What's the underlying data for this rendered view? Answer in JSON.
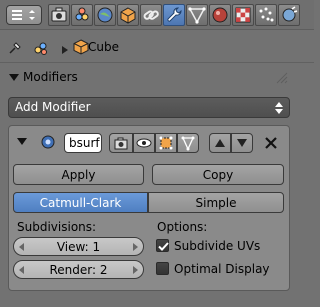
{
  "breadcrumb": {
    "object_name": "Cube"
  },
  "modifiers_section": {
    "title": "Modifiers"
  },
  "add_modifier": {
    "label": "Add Modifier"
  },
  "modifier": {
    "name": "bsurf",
    "apply_label": "Apply",
    "copy_label": "Copy",
    "algorithm": {
      "options": [
        "Catmull-Clark",
        "Simple"
      ],
      "selected": "Catmull-Clark"
    },
    "subdivisions": {
      "label": "Subdivisions:",
      "view": "View: 1",
      "render": "Render: 2"
    },
    "options": {
      "label": "Options:",
      "subdivide_uvs": {
        "label": "Subdivide UVs",
        "checked": true
      },
      "optimal_display": {
        "label": "Optimal Display",
        "checked": false
      }
    }
  },
  "icons": [
    "editor-type-icon",
    "render-icon",
    "scene-icon",
    "world-icon",
    "object-icon",
    "constraints-icon",
    "modifier-wrench-icon",
    "data-mesh-icon",
    "material-icon",
    "texture-icon",
    "particles-icon",
    "pin-icon",
    "link-icon",
    "breadcrumb-arrow-icon",
    "cube-icon"
  ]
}
